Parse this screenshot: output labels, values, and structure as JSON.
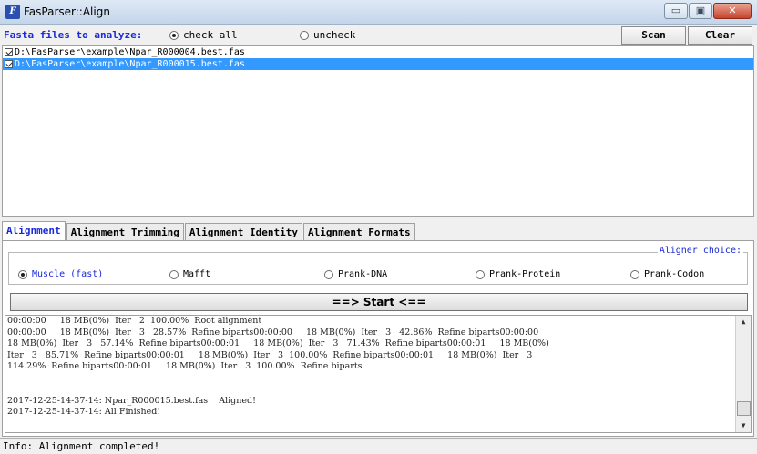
{
  "window": {
    "title": "FasParser::Align",
    "min_glyph": "▭",
    "max_glyph": "▣",
    "close_glyph": "✕"
  },
  "top": {
    "fasta_label": "Fasta files to analyze:",
    "check_all": "check all",
    "uncheck": "uncheck",
    "check_all_selected": true,
    "scan_label": "Scan",
    "clear_label": "Clear"
  },
  "files": [
    {
      "path": "D:\\FasParser\\example\\Npar_R000004.best.fas",
      "checked": true,
      "selected": false
    },
    {
      "path": "D:\\FasParser\\example\\Npar_R000015.best.fas",
      "checked": true,
      "selected": true
    }
  ],
  "tabs": [
    "Alignment",
    "Alignment Trimming",
    "Alignment Identity",
    "Alignment Formats"
  ],
  "aligner": {
    "label": "Aligner choice:",
    "options": [
      "Muscle (fast)",
      "Mafft",
      "Prank-DNA",
      "Prank-Protein",
      "Prank-Codon"
    ],
    "selected": "Muscle (fast)"
  },
  "start_label": "==> Start <==",
  "log": [
    "00:00:00     18 MB(0%)  Iter   2  100.00%  Root alignment",
    "00:00:00     18 MB(0%)  Iter   3   28.57%  Refine biparts00:00:00     18 MB(0%)  Iter   3   42.86%  Refine biparts00:00:00",
    "18 MB(0%)  Iter   3   57.14%  Refine biparts00:00:01     18 MB(0%)  Iter   3   71.43%  Refine biparts00:00:01     18 MB(0%)",
    "Iter   3   85.71%  Refine biparts00:00:01     18 MB(0%)  Iter   3  100.00%  Refine biparts00:00:01     18 MB(0%)  Iter   3",
    "114.29%  Refine biparts00:00:01     18 MB(0%)  Iter   3  100.00%  Refine biparts",
    "",
    "",
    "2017-12-25-14-37-14: Npar_R000015.best.fas    Aligned!",
    "2017-12-25-14-37-14: All Finished!"
  ],
  "scroll_up": "▲",
  "scroll_down": "▼",
  "status": "Info: Alignment completed!"
}
